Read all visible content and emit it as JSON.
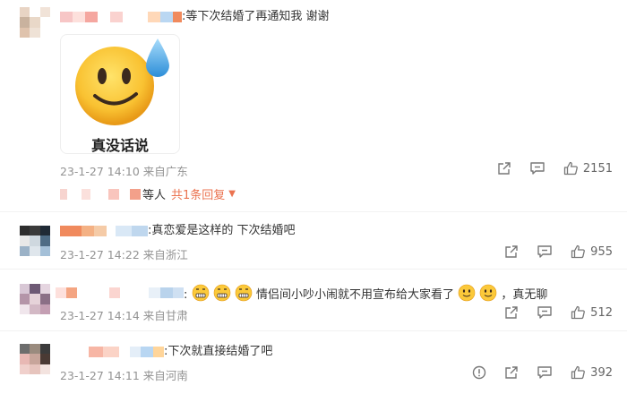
{
  "comments": [
    {
      "text": ":等下次结婚了再通知我 谢谢",
      "sticker_caption": "真没话说",
      "meta": "23-1-27 14:10  来自广东",
      "likes": "2151",
      "replies_prefix": "等人",
      "replies_more": "共1条回复",
      "avatar_colors": [
        "#e8d4c4",
        "#ffffff",
        "#f1e3d8",
        "#c9b29e",
        "#e9d8c8",
        "#ffffff",
        "#dfc3ad",
        "#efe2d6",
        "#ffffff"
      ],
      "name_colors": [
        "#f7c6c6",
        "#fde0dc",
        "#f5a7a0",
        "#ffffff",
        "#fad2cf",
        "#ffffff",
        "#ffffff",
        "#ffd8b8",
        "#bad7f2",
        "#f08a5d"
      ]
    },
    {
      "text": ":真恋爱是这样的 下次结婚吧",
      "meta": "23-1-27 14:22  来自浙江",
      "likes": "955",
      "avatar_colors": [
        "#2d2d2d",
        "#3a3a3a",
        "#1f2a35",
        "#e8e8e8",
        "#cfd8df",
        "#4e6c85",
        "#9bb2c7",
        "#dfe6ec",
        "#a4c0d8"
      ],
      "name_colors": [
        "#f08a5d",
        "#f4b184",
        "#f5cba7",
        "#ffffff",
        "#d9e8f6",
        "#bfd7ee"
      ]
    },
    {
      "text_prefix": ":",
      "text": "情侣间小吵小闹就不用宣布给大家看了",
      "text_suffix": "，真无聊",
      "meta": "23-1-27 14:14  来自甘肃",
      "likes": "512",
      "avatar_colors": [
        "#d8c7d5",
        "#6e5a75",
        "#e5d5e0",
        "#b495a8",
        "#e6d3d9",
        "#8b6f86",
        "#f0e6ec",
        "#d3b9c5",
        "#c49fb3"
      ],
      "name_colors": [
        "#fde0dc",
        "#f4a582",
        "#ffffff",
        "#ffffff",
        "#fbd5d0",
        "#ffffff",
        "#e8f0f8",
        "#b9d3ec",
        "#cfe0f2"
      ]
    },
    {
      "text": ":下次就直接结婚了吧",
      "meta": "23-1-27 14:11  来自河南",
      "likes": "392",
      "avatar_colors": [
        "#6d6d6d",
        "#9a8b7e",
        "#3b3b3b",
        "#e8b8b4",
        "#c7a59a",
        "#4a3a34",
        "#f0d0cc",
        "#e6c4bd",
        "#f3e3df"
      ],
      "name_colors": [
        "#ffffff",
        "#ffffff",
        "#f7b6a5",
        "#fbd3c6",
        "#ffffff",
        "#e4eef8",
        "#b8d6f2",
        "#ffd59a"
      ]
    }
  ],
  "icons": {
    "share": "share-icon",
    "comment": "comment-icon",
    "like": "like-icon",
    "report": "report-icon"
  }
}
